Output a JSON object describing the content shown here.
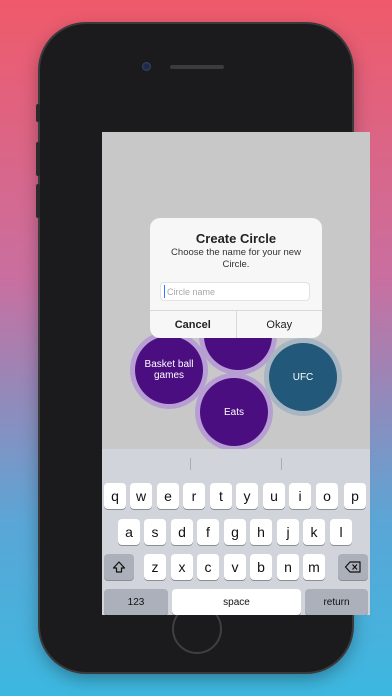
{
  "dialog": {
    "title": "Create Circle",
    "message": "Choose the name for your new Circle.",
    "input_value": "",
    "input_placeholder": "Circle name",
    "cancel_label": "Cancel",
    "ok_label": "Okay"
  },
  "circles": [
    {
      "label": "Basket ball games",
      "color": "#4a0e80"
    },
    {
      "label": "",
      "color": "#4a0e80"
    },
    {
      "label": "Eats",
      "color": "#4a0e80"
    },
    {
      "label": "UFC",
      "color": "#22587a"
    }
  ],
  "keyboard": {
    "row1": [
      "q",
      "w",
      "e",
      "r",
      "t",
      "y",
      "u",
      "i",
      "o",
      "p"
    ],
    "row2": [
      "a",
      "s",
      "d",
      "f",
      "g",
      "h",
      "j",
      "k",
      "l"
    ],
    "row3": [
      "z",
      "x",
      "c",
      "v",
      "b",
      "n",
      "m"
    ],
    "shift_icon": "shift-arrow-icon",
    "delete_icon": "backspace-icon",
    "numbers_label": "123",
    "space_label": "space",
    "return_label": "return"
  },
  "colors": {
    "accent_purple": "#4a0e80",
    "accent_teal": "#22587a",
    "background_gradient_top": "#ef5a6a",
    "background_gradient_bottom": "#3cb8e0"
  }
}
